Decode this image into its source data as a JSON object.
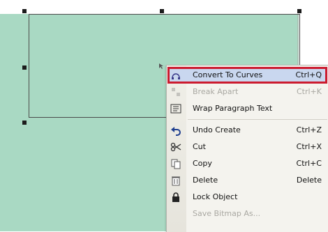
{
  "menu": {
    "items": [
      {
        "label": "Convert To Curves",
        "shortcut": "Ctrl+Q",
        "icon": "convert-curves-icon",
        "highlighted": true,
        "enabled": true
      },
      {
        "label": "Break Apart",
        "shortcut": "Ctrl+K",
        "icon": "break-apart-icon",
        "highlighted": false,
        "enabled": false
      },
      {
        "label": "Wrap Paragraph Text",
        "shortcut": "",
        "icon": "wrap-text-icon",
        "highlighted": false,
        "enabled": true
      },
      {
        "label": "Undo Create",
        "shortcut": "Ctrl+Z",
        "icon": "undo-icon",
        "highlighted": false,
        "enabled": true
      },
      {
        "label": "Cut",
        "shortcut": "Ctrl+X",
        "icon": "scissors-icon",
        "highlighted": false,
        "enabled": true
      },
      {
        "label": "Copy",
        "shortcut": "Ctrl+C",
        "icon": "copy-icon",
        "highlighted": false,
        "enabled": true
      },
      {
        "label": "Delete",
        "shortcut": "Delete",
        "icon": "trash-icon",
        "highlighted": false,
        "enabled": true
      },
      {
        "label": "Lock Object",
        "shortcut": "",
        "icon": "lock-icon",
        "highlighted": false,
        "enabled": true
      },
      {
        "label": "Save Bitmap As...",
        "shortcut": "",
        "icon": "",
        "highlighted": false,
        "enabled": false
      }
    ]
  },
  "colors": {
    "canvas_fill": "#a9d9c3",
    "menu_background": "#f4f3ee",
    "highlight_border": "#cc1b2f",
    "highlight_fill": "#c9d7ef",
    "handle": "#1c1c1c"
  }
}
